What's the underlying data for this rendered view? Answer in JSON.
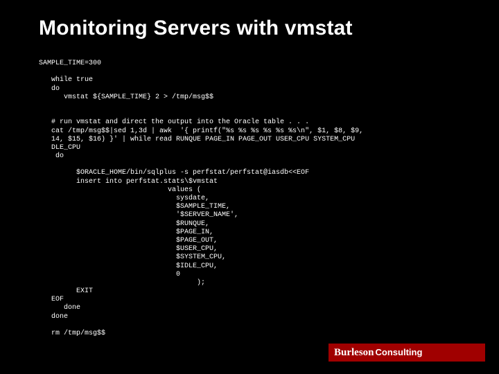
{
  "title": "Monitoring Servers with vmstat",
  "code": "SAMPLE_TIME=300\n\n   while true\n   do\n      vmstat ${SAMPLE_TIME} 2 > /tmp/msg$$\n\n\n   # run vmstat and direct the output into the Oracle table . . .\n   cat /tmp/msg$$|sed 1,3d | awk  '{ printf(\"%s %s %s %s %s %s\\n\", $1, $8, $9,\n   14, $15, $16) }' | while read RUNQUE PAGE_IN PAGE_OUT USER_CPU SYSTEM_CPU\n   DLE_CPU\n    do\n\n         $ORACLE_HOME/bin/sqlplus -s perfstat/perfstat@iasdb<<EOF\n         insert into perfstat.stats\\$vmstat\n                               values (\n                                 sysdate,\n                                 $SAMPLE_TIME,\n                                 '$SERVER_NAME',\n                                 $RUNQUE,\n                                 $PAGE_IN,\n                                 $PAGE_OUT,\n                                 $USER_CPU,\n                                 $SYSTEM_CPU,\n                                 $IDLE_CPU,\n                                 0\n                                      );\n         EXIT\n   EOF\n      done\n   done\n\n   rm /tmp/msg$$",
  "brand_main": "Burleson",
  "brand_sub": "Consulting"
}
